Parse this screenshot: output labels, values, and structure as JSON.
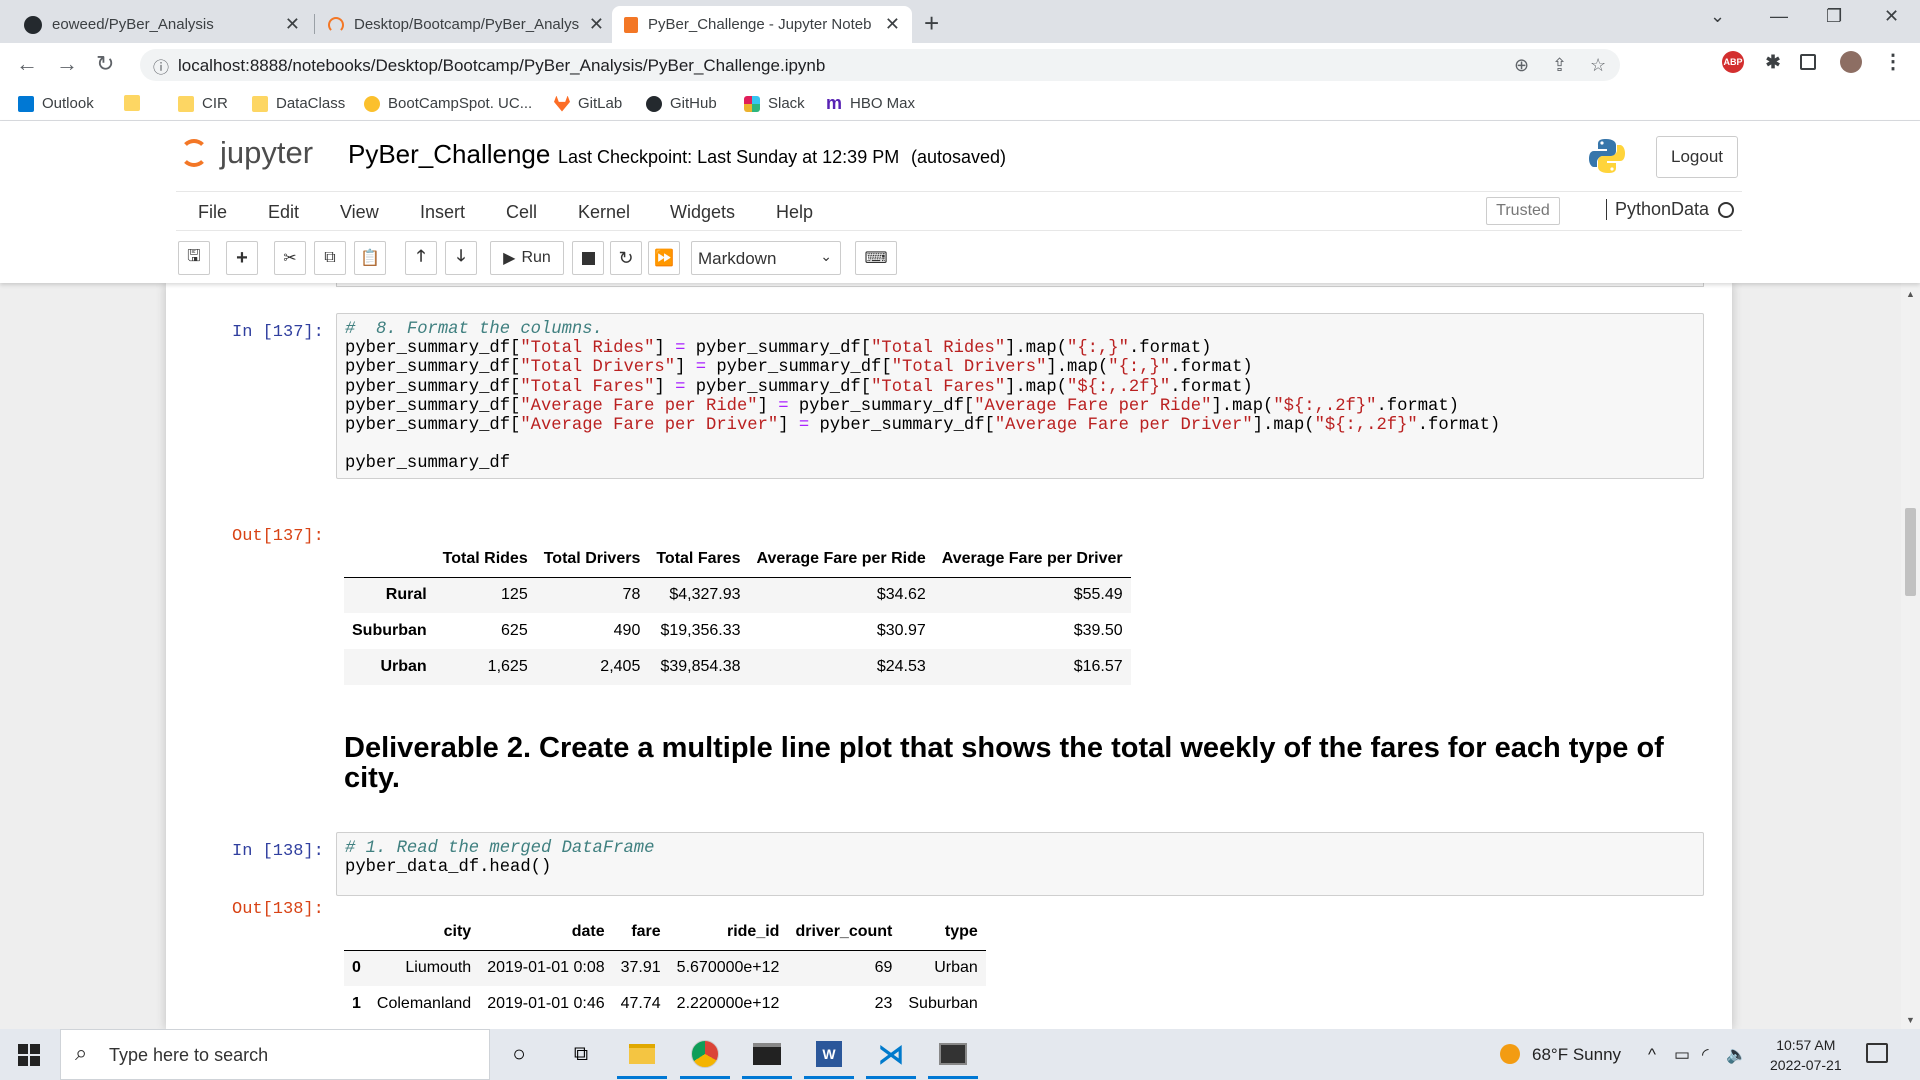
{
  "browser": {
    "tabs": [
      {
        "title": "eoweed/PyBer_Analysis",
        "active": false
      },
      {
        "title": "Desktop/Bootcamp/PyBer_Analys",
        "active": false
      },
      {
        "title": "PyBer_Challenge - Jupyter Noteb",
        "active": true
      }
    ],
    "url": "localhost:8888/notebooks/Desktop/Bootcamp/PyBer_Analysis/PyBer_Challenge.ipynb",
    "bookmarks": [
      "Outlook",
      "",
      "CIR",
      "DataClass",
      "BootCampSpot. UC...",
      "GitLab",
      "GitHub",
      "Slack",
      "HBO Max"
    ],
    "extension_badge": "ABP"
  },
  "jupyter": {
    "logo_text": "jupyter",
    "notebook_name": "PyBer_Challenge",
    "checkpoint": "Last Checkpoint: Last Sunday at 12:39 PM",
    "autosave": "(autosaved)",
    "logout_label": "Logout",
    "menu": [
      "File",
      "Edit",
      "View",
      "Insert",
      "Cell",
      "Kernel",
      "Widgets",
      "Help"
    ],
    "trusted_label": "Trusted",
    "kernel_name": "PythonData",
    "run_label": "Run",
    "cell_type": "Markdown"
  },
  "cells": {
    "in137": {
      "prompt": "In [137]:",
      "lines": [
        {
          "parts": [
            [
              "c",
              "#  8. Format the columns."
            ]
          ]
        },
        {
          "parts": [
            [
              "t",
              "pyber_summary_df["
            ],
            [
              "s",
              "\"Total Rides\""
            ],
            [
              "t",
              "] "
            ],
            [
              "o",
              "="
            ],
            [
              "t",
              " pyber_summary_df["
            ],
            [
              "s",
              "\"Total Rides\""
            ],
            [
              "t",
              "].map("
            ],
            [
              "s",
              "\"{:,}\""
            ],
            [
              "t",
              ".format)"
            ]
          ]
        },
        {
          "parts": [
            [
              "t",
              "pyber_summary_df["
            ],
            [
              "s",
              "\"Total Drivers\""
            ],
            [
              "t",
              "] "
            ],
            [
              "o",
              "="
            ],
            [
              "t",
              " pyber_summary_df["
            ],
            [
              "s",
              "\"Total Drivers\""
            ],
            [
              "t",
              "].map("
            ],
            [
              "s",
              "\"{:,}\""
            ],
            [
              "t",
              ".format)"
            ]
          ]
        },
        {
          "parts": [
            [
              "t",
              "pyber_summary_df["
            ],
            [
              "s",
              "\"Total Fares\""
            ],
            [
              "t",
              "] "
            ],
            [
              "o",
              "="
            ],
            [
              "t",
              " pyber_summary_df["
            ],
            [
              "s",
              "\"Total Fares\""
            ],
            [
              "t",
              "].map("
            ],
            [
              "s",
              "\"${:,.2f}\""
            ],
            [
              "t",
              ".format)"
            ]
          ]
        },
        {
          "parts": [
            [
              "t",
              "pyber_summary_df["
            ],
            [
              "s",
              "\"Average Fare per Ride\""
            ],
            [
              "t",
              "] "
            ],
            [
              "o",
              "="
            ],
            [
              "t",
              " pyber_summary_df["
            ],
            [
              "s",
              "\"Average Fare per Ride\""
            ],
            [
              "t",
              "].map("
            ],
            [
              "s",
              "\"${:,.2f}\""
            ],
            [
              "t",
              ".format)"
            ]
          ]
        },
        {
          "parts": [
            [
              "t",
              "pyber_summary_df["
            ],
            [
              "s",
              "\"Average Fare per Driver\""
            ],
            [
              "t",
              "] "
            ],
            [
              "o",
              "="
            ],
            [
              "t",
              " pyber_summary_df["
            ],
            [
              "s",
              "\"Average Fare per Driver\""
            ],
            [
              "t",
              "].map("
            ],
            [
              "s",
              "\"${:,.2f}\""
            ],
            [
              "t",
              ".format)"
            ]
          ]
        },
        {
          "parts": [
            [
              "t",
              ""
            ]
          ]
        },
        {
          "parts": [
            [
              "t",
              "pyber_summary_df"
            ]
          ]
        }
      ]
    },
    "out137": {
      "prompt": "Out[137]:",
      "columns": [
        "",
        "Total Rides",
        "Total Drivers",
        "Total Fares",
        "Average Fare per Ride",
        "Average Fare per Driver"
      ],
      "rows": [
        [
          "Rural",
          "125",
          "78",
          "$4,327.93",
          "$34.62",
          "$55.49"
        ],
        [
          "Suburban",
          "625",
          "490",
          "$19,356.33",
          "$30.97",
          "$39.50"
        ],
        [
          "Urban",
          "1,625",
          "2,405",
          "$39,854.38",
          "$24.53",
          "$16.57"
        ]
      ]
    },
    "markdown": "Deliverable 2. Create a multiple line plot that shows the total weekly of the fares for each type of city.",
    "in138": {
      "prompt": "In [138]:",
      "lines": [
        {
          "parts": [
            [
              "c",
              "# 1. Read the merged DataFrame"
            ]
          ]
        },
        {
          "parts": [
            [
              "t",
              "pyber_data_df.head()"
            ]
          ]
        }
      ]
    },
    "out138": {
      "prompt": "Out[138]:",
      "columns": [
        "",
        "city",
        "date",
        "fare",
        "ride_id",
        "driver_count",
        "type"
      ],
      "rows": [
        [
          "0",
          "Liumouth",
          "2019-01-01 0:08",
          "37.91",
          "5.670000e+12",
          "69",
          "Urban"
        ],
        [
          "1",
          "Colemanland",
          "2019-01-01 0:46",
          "47.74",
          "2.220000e+12",
          "23",
          "Suburban"
        ]
      ]
    }
  },
  "taskbar": {
    "search_placeholder": "Type here to search",
    "weather": "68°F  Sunny",
    "time": "10:57 AM",
    "date": "2022-07-21"
  },
  "colors": {
    "jupyter_orange": "#f37726",
    "prompt_in": "#303f9f",
    "prompt_out": "#d84315",
    "code_comment": "#408080",
    "code_string": "#ba2121"
  }
}
